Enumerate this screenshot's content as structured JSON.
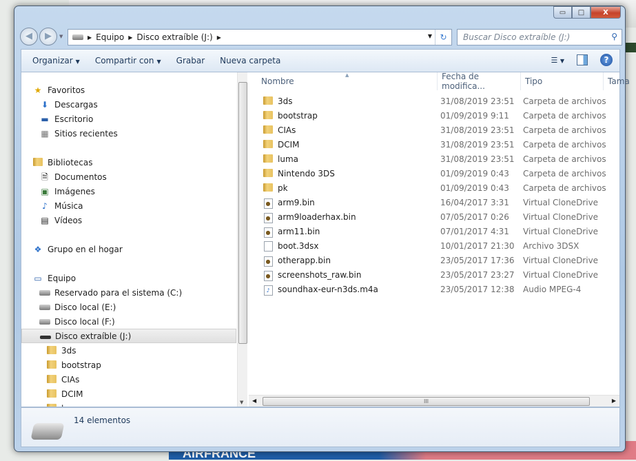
{
  "window": {
    "min": "▭",
    "max": "□",
    "close": "X"
  },
  "address": {
    "root_icon": "drive-icon",
    "crumbs": [
      "Equipo",
      "Disco extraíble (J:)"
    ],
    "search_placeholder": "Buscar Disco extraíble (J:)"
  },
  "toolbar": {
    "organize": "Organizar",
    "share": "Compartir con",
    "burn": "Grabar",
    "new_folder": "Nueva carpeta"
  },
  "nav": {
    "favorites": "Favoritos",
    "fav_items": [
      "Descargas",
      "Escritorio",
      "Sitios recientes"
    ],
    "libraries": "Bibliotecas",
    "lib_items": [
      "Documentos",
      "Imágenes",
      "Música",
      "Vídeos"
    ],
    "homegroup": "Grupo en el hogar",
    "computer": "Equipo",
    "drives": [
      "Reservado para el sistema (C:)",
      "Disco local (E:)",
      "Disco local (F:)",
      "Disco extraíble (J:)"
    ],
    "subfolders": [
      "3ds",
      "bootstrap",
      "CIAs",
      "DCIM",
      "luma"
    ]
  },
  "columns": {
    "name": "Nombre",
    "date": "Fecha de modifica...",
    "type": "Tipo",
    "size": "Tama"
  },
  "files": [
    {
      "name": "3ds",
      "date": "31/08/2019 23:51",
      "type": "Carpeta de archivos",
      "kind": "folder"
    },
    {
      "name": "bootstrap",
      "date": "01/09/2019 9:11",
      "type": "Carpeta de archivos",
      "kind": "folder"
    },
    {
      "name": "CIAs",
      "date": "31/08/2019 23:51",
      "type": "Carpeta de archivos",
      "kind": "folder"
    },
    {
      "name": "DCIM",
      "date": "31/08/2019 23:51",
      "type": "Carpeta de archivos",
      "kind": "folder"
    },
    {
      "name": "luma",
      "date": "31/08/2019 23:51",
      "type": "Carpeta de archivos",
      "kind": "folder"
    },
    {
      "name": "Nintendo 3DS",
      "date": "01/09/2019 0:43",
      "type": "Carpeta de archivos",
      "kind": "folder"
    },
    {
      "name": "pk",
      "date": "01/09/2019 0:43",
      "type": "Carpeta de archivos",
      "kind": "folder"
    },
    {
      "name": "arm9.bin",
      "date": "16/04/2017 3:31",
      "type": "Virtual CloneDrive",
      "kind": "bin"
    },
    {
      "name": "arm9loaderhax.bin",
      "date": "07/05/2017 0:26",
      "type": "Virtual CloneDrive",
      "kind": "bin"
    },
    {
      "name": "arm11.bin",
      "date": "07/01/2017 4:31",
      "type": "Virtual CloneDrive",
      "kind": "bin"
    },
    {
      "name": "boot.3dsx",
      "date": "10/01/2017 21:30",
      "type": "Archivo 3DSX",
      "kind": "file"
    },
    {
      "name": "otherapp.bin",
      "date": "23/05/2017 17:36",
      "type": "Virtual CloneDrive",
      "kind": "bin"
    },
    {
      "name": "screenshots_raw.bin",
      "date": "23/05/2017 23:27",
      "type": "Virtual CloneDrive",
      "kind": "bin"
    },
    {
      "name": "soundhax-eur-n3ds.m4a",
      "date": "23/05/2017 12:38",
      "type": "Audio MPEG-4",
      "kind": "audio"
    }
  ],
  "status": {
    "count": "14 elementos"
  },
  "background": {
    "ad_text": "AIRFRANCE"
  }
}
